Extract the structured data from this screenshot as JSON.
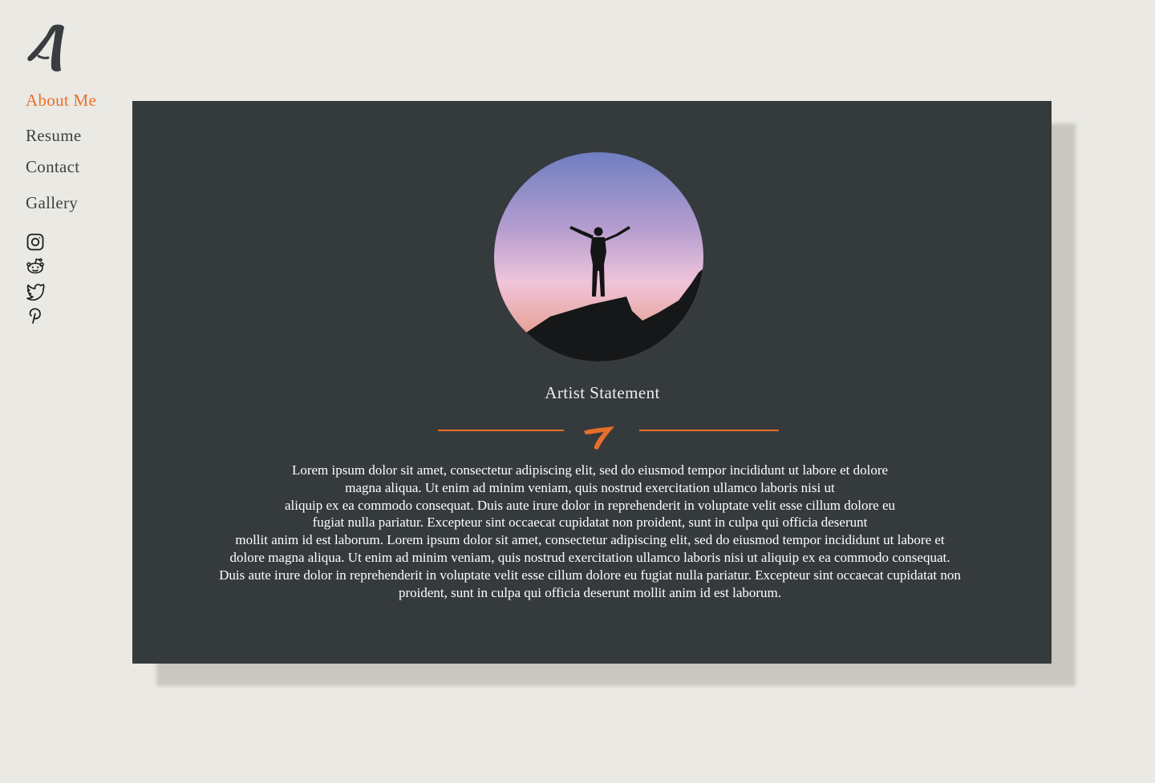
{
  "logo": {
    "icon": "brush-stroke-a-logo",
    "color": "#3f4143"
  },
  "nav": {
    "items": [
      {
        "label": "About Me",
        "active": true
      },
      {
        "label": "Resume",
        "active": false
      },
      {
        "label": "Contact",
        "active": false
      },
      {
        "label": "Gallery",
        "active": false
      }
    ]
  },
  "social": {
    "icons": [
      "instagram-icon",
      "reddit-icon",
      "twitter-icon",
      "pinterest-icon"
    ]
  },
  "profile": {
    "image": "silhouette of a person with raised arms standing on a rock at sunset"
  },
  "statement": {
    "heading": "Artist Statement",
    "body": "Lorem ipsum dolor sit amet, consectetur adipiscing elit, sed do eiusmod tempor incididunt ut labore et dolore\nmagna aliqua. Ut enim ad minim veniam, quis nostrud exercitation ullamco laboris nisi ut\naliquip ex ea commodo consequat. Duis aute irure dolor in reprehenderit in voluptate velit esse cillum dolore eu\nfugiat nulla pariatur. Excepteur sint occaecat cupidatat non proident, sunt in culpa qui officia deserunt\nmollit anim id est laborum. Lorem ipsum dolor sit amet, consectetur adipiscing elit, sed do eiusmod tempor incididunt ut labore et\ndolore  magna aliqua.  Ut enim ad minim veniam, quis nostrud  exercitation ullamco laboris nisi ut aliquip ex ea commodo consequat.\nDuis aute irure dolor in  reprehenderit in voluptate velit esse cillum dolore eu fugiat nulla pariatur. Excepteur sint occaecat cupidatat non\nproident,  sunt in culpa qui officia deserunt mollit anim id est laborum."
  },
  "colors": {
    "accent": "#e86f2a",
    "background": "#eae9e4",
    "card": "#353a3d",
    "nav_text": "#3f4143"
  }
}
